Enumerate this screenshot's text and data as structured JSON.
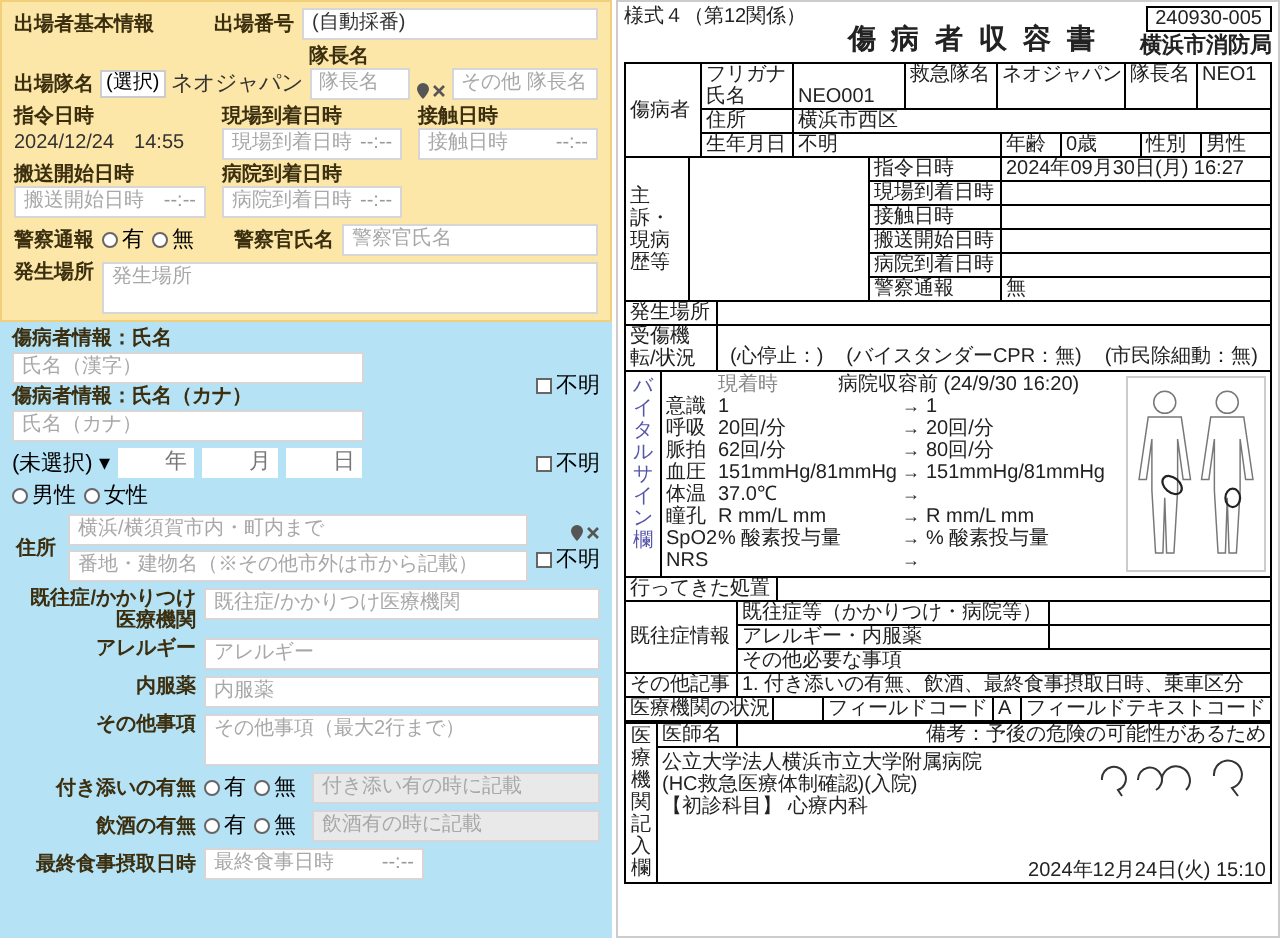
{
  "form": {
    "basic": {
      "section_label": "出場者基本情報",
      "dispatch_no": {
        "label": "出場番号",
        "value": "(自動採番)"
      },
      "unit": {
        "label": "出場隊名",
        "select": "(選択)",
        "unit_name": "ネオジャパン",
        "captain_label": "隊長名",
        "captain_placeholder": "隊長名",
        "other_placeholder": "その他 隊長名"
      },
      "times": [
        {
          "label": "指令日時",
          "value": "2024/12/24　14:55"
        },
        {
          "label": "現場到着日時",
          "placeholder": "現場到着日時",
          "time": "--:--"
        },
        {
          "label": "接触日時",
          "placeholder": "接触日時",
          "time": "--:--"
        },
        {
          "label": "搬送開始日時",
          "placeholder": "搬送開始日時",
          "time": "--:--"
        },
        {
          "label": "病院到着日時",
          "placeholder": "病院到着日時",
          "time": "--:--"
        }
      ],
      "police": {
        "label": "警察通報",
        "options": [
          {
            "label": "有",
            "selected": false
          },
          {
            "label": "無",
            "selected": false
          }
        ],
        "officer_label": "警察官氏名",
        "officer_placeholder": "警察官氏名"
      },
      "location": {
        "label": "発生場所",
        "placeholder": "発生場所"
      }
    },
    "patient": {
      "name": {
        "label": "傷病者情報：氏名",
        "placeholder": "氏名（漢字）"
      },
      "kana": {
        "label": "傷病者情報：氏名（カナ）",
        "placeholder": "氏名（カナ）"
      },
      "name_unknown": {
        "label": "不明",
        "checked": false
      },
      "birth": {
        "era": "(未選択)",
        "caret": "▾",
        "year": "年",
        "month": "月",
        "day": "日",
        "unknown": {
          "label": "不明",
          "checked": false
        }
      },
      "sex": [
        {
          "label": "男性",
          "selected": false
        },
        {
          "label": "女性",
          "selected": false
        }
      ],
      "address": {
        "label": "住所",
        "line1": "横浜/横須賀市内・町内まで",
        "line2": "番地・建物名（※その他市外は市から記載）",
        "unknown": {
          "label": "不明",
          "checked": false
        }
      },
      "fields": [
        {
          "kind": "input",
          "label": "既往症/かかりつけ医療機関",
          "placeholder": "既往症/かかりつけ医療機関"
        },
        {
          "kind": "input",
          "label": "アレルギー",
          "placeholder": "アレルギー"
        },
        {
          "kind": "input",
          "label": "内服薬",
          "placeholder": "内服薬"
        },
        {
          "kind": "textarea",
          "label": "その他事項",
          "placeholder": "その他事項（最大2行まで）"
        }
      ],
      "yesno": [
        {
          "label": "付き添いの有無",
          "options": [
            {
              "label": "有",
              "selected": false
            },
            {
              "label": "無",
              "selected": false
            }
          ],
          "placeholder": "付き添い有の時に記載",
          "disabled": true
        },
        {
          "label": "飲酒の有無",
          "options": [
            {
              "label": "有",
              "selected": false
            },
            {
              "label": "無",
              "selected": false
            }
          ],
          "placeholder": "飲酒有の時に記載",
          "disabled": true
        }
      ],
      "last_meal": {
        "label": "最終食事摂取日時",
        "placeholder": "最終食事日時",
        "time": "--:--"
      }
    }
  },
  "document": {
    "form_no": "様式４（第12関係）",
    "title": "傷 病 者 収 容 書",
    "doc_no": "240930-005",
    "issuer": "横浜市消防局",
    "patient": {
      "section": "傷病者",
      "kana_label": "フリガナ",
      "name_label": "氏名",
      "name": "NEO001",
      "unit_label": "救急隊名",
      "unit": "ネオジャパン",
      "captain_label": "隊長名",
      "captain": "NEO1",
      "address_label": "住所",
      "address": "横浜市西区",
      "birth_label": "生年月日",
      "birth": "不明",
      "age_label": "年齢",
      "age": "0歳",
      "sex_label": "性別",
      "sex": "男性"
    },
    "situation_label": "主訴・現病歴等",
    "times": [
      {
        "label": "指令日時",
        "value": "2024年09月30日(月) 16:27"
      },
      {
        "label": "現場到着日時"
      },
      {
        "label": "接触日時"
      },
      {
        "label": "搬送開始日時"
      },
      {
        "label": "病院到着日時"
      },
      {
        "label": "警察通報",
        "value": "無"
      }
    ],
    "location_label": "発生場所",
    "injury": {
      "label": "受傷機転/状況",
      "items": [
        "(心停止：)",
        "(バイスタンダーCPR：無)",
        "(市民除細動：無)"
      ]
    },
    "vitals": {
      "label": "バイタルサイン欄",
      "header_before": "現着時",
      "header_after": "病院収容前 (24/9/30 16:20)",
      "rows": [
        {
          "name": "意識",
          "before": "1",
          "arrow": "→",
          "after": "1"
        },
        {
          "name": "呼吸",
          "before": "20回/分",
          "arrow": "→",
          "after": "20回/分"
        },
        {
          "name": "脈拍",
          "before": "62回/分",
          "arrow": "→",
          "after": "80回/分"
        },
        {
          "name": "血圧",
          "before": "151mmHg/81mmHg",
          "arrow": "→",
          "after": "151mmHg/81mmHg"
        },
        {
          "name": "体温",
          "before": "37.0℃",
          "arrow": "→"
        },
        {
          "name": "瞳孔",
          "before": "R mm/L mm",
          "arrow": "→",
          "after": "R mm/L mm"
        },
        {
          "name": "SpO2",
          "before": "% 酸素投与量",
          "arrow": "→",
          "after": "% 酸素投与量"
        },
        {
          "name": "NRS",
          "arrow": "→"
        }
      ]
    },
    "treatment_label": "行ってきた処置",
    "history": {
      "label": "既往症情報",
      "rows": [
        "既往症等（かかりつけ・病院等）",
        "アレルギー・内服薬",
        "その他必要な事項"
      ]
    },
    "other": {
      "label": "その他記事",
      "text": "1. 付き添いの有無、飲酒、最終食事摂取日時、乗車区分"
    },
    "hospital": {
      "label": "医療機関の状況",
      "field1": "フィールドコード",
      "value1": "A",
      "field2": "フィールドテキストコード"
    },
    "receipt": {
      "label": "医療機関記入欄",
      "doctor_label": "医師名",
      "note": "備考：予後の危険の可能性があるため",
      "hospital": [
        "公立大学法人横浜市立大学附属病院",
        "(HC救急医療体制確認)(入院)",
        "【初診科目】 心療内科"
      ],
      "date": "2024年12月24日(火) 15:10"
    }
  }
}
